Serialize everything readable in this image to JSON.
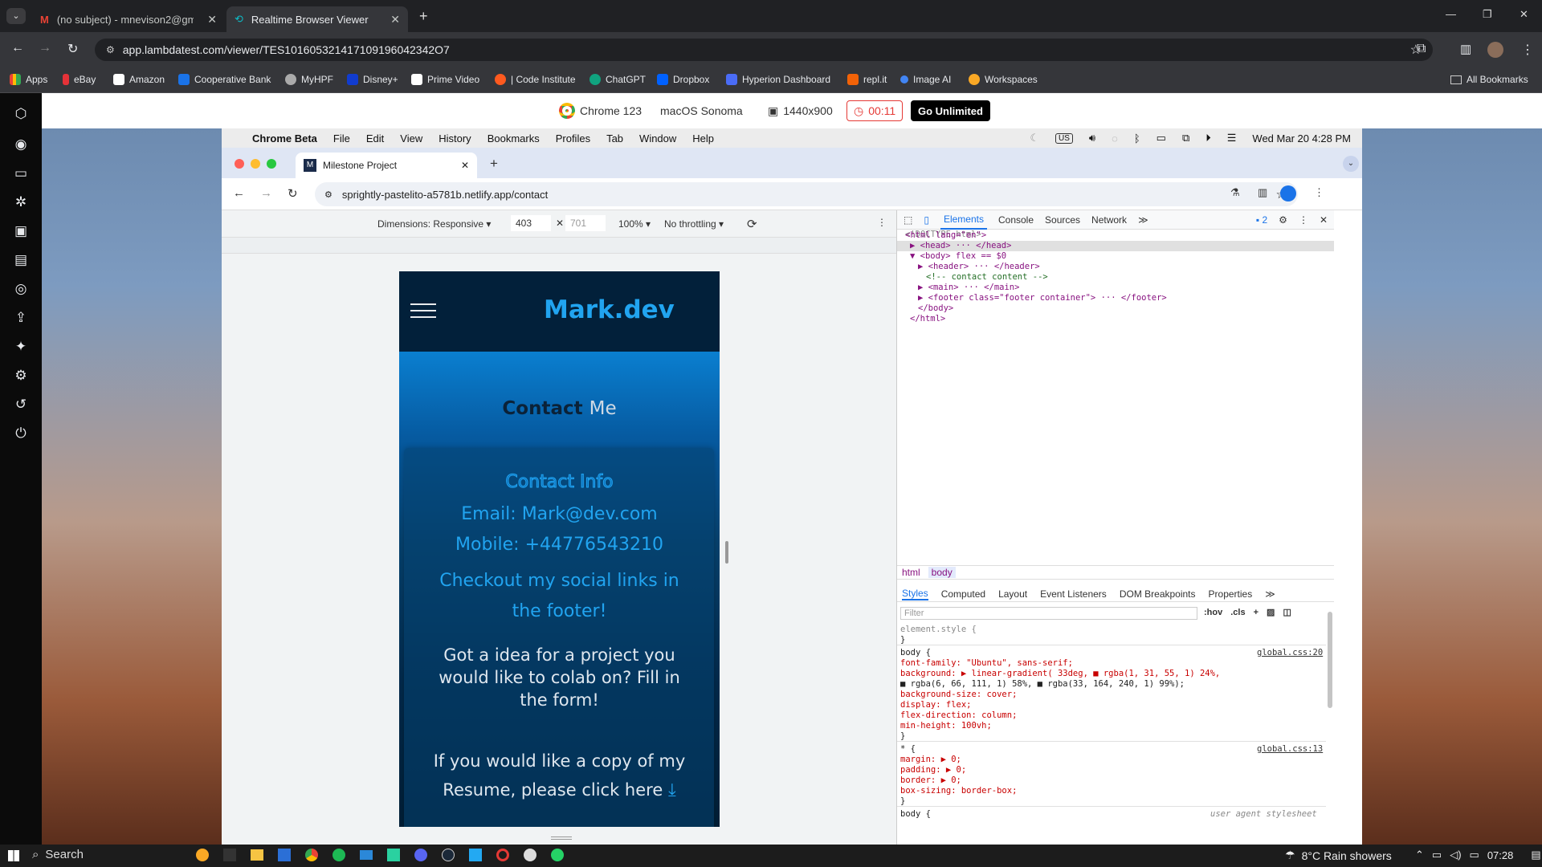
{
  "outer_tabs": [
    {
      "title": "(no subject) - mnevison2@gm",
      "icon": "gmail-icon"
    },
    {
      "title": "Realtime Browser Viewer",
      "icon": "lambdatest-icon"
    }
  ],
  "outer_url": "app.lambdatest.com/viewer/TES101605321417109196042342O7",
  "bookmarks": [
    "Apps",
    "eBay",
    "Amazon",
    "Cooperative Bank",
    "MyHPF",
    "Disney+",
    "Prime Video",
    "| Code Institute",
    "ChatGPT",
    "Dropbox",
    "Hyperion Dashboard",
    "repl.it",
    "Image AI",
    "Workspaces"
  ],
  "all_bookmarks": "All Bookmarks",
  "lambdatest": {
    "browser": "Chrome 123",
    "os": "macOS Sonoma",
    "resolution": "1440x900",
    "timer": "00:11",
    "upgrade": "Go Unlimited"
  },
  "mac_menu": [
    "Chrome Beta",
    "File",
    "Edit",
    "View",
    "History",
    "Bookmarks",
    "Profiles",
    "Tab",
    "Window",
    "Help"
  ],
  "mac_clock": "Wed Mar 20  4:28 PM",
  "mac_input": "US",
  "inner_tab": "Milestone Project",
  "inner_url": "sprightly-pastelito-a5781b.netlify.app/contact",
  "device": {
    "dimensions": "Dimensions: Responsive",
    "width": "403",
    "height": "701",
    "zoom": "100%",
    "throttle": "No throttling"
  },
  "site": {
    "brand": "Mark.dev",
    "title_a": "Contact",
    "title_b": "Me",
    "info_heading": "Contact Info",
    "email": "Email: Mark@dev.com",
    "mobile": "Mobile: +44776543210",
    "social": "Checkout my social links in the footer!",
    "collab": "Got a idea for a project you would like to colab on? Fill in the form!",
    "resume": "If you would like a copy of my Resume, please click here"
  },
  "devtools": {
    "tabs": [
      "Elements",
      "Console",
      "Sources",
      "Network"
    ],
    "issues": "2",
    "dom": [
      {
        "indent": 0,
        "text": "<!DOCTYPE html>",
        "cls": "cmgrey"
      },
      {
        "indent": 0,
        "text": "<html lang=\"en\">",
        "cls": "tag"
      },
      {
        "indent": 1,
        "text": "▶ <head> ··· </head>",
        "cls": "tag"
      },
      {
        "indent": 1,
        "text": "▼ <body>  flex  == $0",
        "cls": "tag"
      },
      {
        "indent": 2,
        "text": "▶ <header> ··· </header>",
        "cls": "tag"
      },
      {
        "indent": 3,
        "text": "<!-- contact content  -->",
        "cls": "cm"
      },
      {
        "indent": 2,
        "text": "▶ <main> ··· </main>",
        "cls": "tag"
      },
      {
        "indent": 2,
        "text": "▶ <footer class=\"footer container\"> ··· </footer>",
        "cls": "tag"
      },
      {
        "indent": 2,
        "text": "</body>",
        "cls": "tag"
      },
      {
        "indent": 1,
        "text": "</html>",
        "cls": "tag"
      }
    ],
    "crumbs": [
      "html",
      "body"
    ],
    "style_tabs": [
      "Styles",
      "Computed",
      "Layout",
      "Event Listeners",
      "DOM Breakpoints",
      "Properties"
    ],
    "filter_placeholder": "Filter",
    "hov": ":hov",
    "cls": ".cls",
    "css": [
      "element.style {",
      "}",
      "body {",
      "  font-family: \"Ubuntu\", sans-serif;",
      "  background: ▶ linear-gradient( 33deg, ■ rgba(1, 31, 55, 1) 24%,",
      "      ■ rgba(6, 66, 111, 1) 58%, ■ rgba(33, 164, 240, 1) 99%);",
      "  background-size: cover;",
      "  display: flex;",
      "  flex-direction: column;",
      "  min-height: 100vh;",
      "}",
      "* {",
      "  margin: ▶ 0;",
      "  padding: ▶ 0;",
      "  border: ▶ 0;",
      "  box-sizing: border-box;",
      "}",
      "body {"
    ],
    "src1": "global.css:20",
    "src2": "global.css:13",
    "src3": "user agent stylesheet"
  },
  "taskbar": {
    "search": "Search",
    "weather": "8°C  Rain showers",
    "time": "07:28"
  },
  "colors": {
    "site_dark": "#011f37",
    "site_mid": "#06426f",
    "site_light": "#21a4f0",
    "accent": "#21a4f0",
    "devtools_blue": "#1a73e8"
  }
}
